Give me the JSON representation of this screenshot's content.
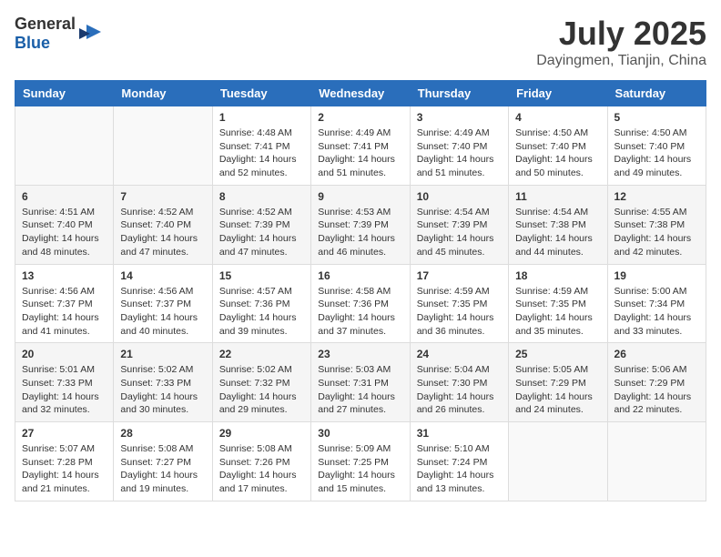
{
  "header": {
    "logo_general": "General",
    "logo_blue": "Blue",
    "month": "July 2025",
    "location": "Dayingmen, Tianjin, China"
  },
  "weekdays": [
    "Sunday",
    "Monday",
    "Tuesday",
    "Wednesday",
    "Thursday",
    "Friday",
    "Saturday"
  ],
  "weeks": [
    [
      {
        "day": "",
        "sunrise": "",
        "sunset": "",
        "daylight": ""
      },
      {
        "day": "",
        "sunrise": "",
        "sunset": "",
        "daylight": ""
      },
      {
        "day": "1",
        "sunrise": "Sunrise: 4:48 AM",
        "sunset": "Sunset: 7:41 PM",
        "daylight": "Daylight: 14 hours and 52 minutes."
      },
      {
        "day": "2",
        "sunrise": "Sunrise: 4:49 AM",
        "sunset": "Sunset: 7:41 PM",
        "daylight": "Daylight: 14 hours and 51 minutes."
      },
      {
        "day": "3",
        "sunrise": "Sunrise: 4:49 AM",
        "sunset": "Sunset: 7:40 PM",
        "daylight": "Daylight: 14 hours and 51 minutes."
      },
      {
        "day": "4",
        "sunrise": "Sunrise: 4:50 AM",
        "sunset": "Sunset: 7:40 PM",
        "daylight": "Daylight: 14 hours and 50 minutes."
      },
      {
        "day": "5",
        "sunrise": "Sunrise: 4:50 AM",
        "sunset": "Sunset: 7:40 PM",
        "daylight": "Daylight: 14 hours and 49 minutes."
      }
    ],
    [
      {
        "day": "6",
        "sunrise": "Sunrise: 4:51 AM",
        "sunset": "Sunset: 7:40 PM",
        "daylight": "Daylight: 14 hours and 48 minutes."
      },
      {
        "day": "7",
        "sunrise": "Sunrise: 4:52 AM",
        "sunset": "Sunset: 7:40 PM",
        "daylight": "Daylight: 14 hours and 47 minutes."
      },
      {
        "day": "8",
        "sunrise": "Sunrise: 4:52 AM",
        "sunset": "Sunset: 7:39 PM",
        "daylight": "Daylight: 14 hours and 47 minutes."
      },
      {
        "day": "9",
        "sunrise": "Sunrise: 4:53 AM",
        "sunset": "Sunset: 7:39 PM",
        "daylight": "Daylight: 14 hours and 46 minutes."
      },
      {
        "day": "10",
        "sunrise": "Sunrise: 4:54 AM",
        "sunset": "Sunset: 7:39 PM",
        "daylight": "Daylight: 14 hours and 45 minutes."
      },
      {
        "day": "11",
        "sunrise": "Sunrise: 4:54 AM",
        "sunset": "Sunset: 7:38 PM",
        "daylight": "Daylight: 14 hours and 44 minutes."
      },
      {
        "day": "12",
        "sunrise": "Sunrise: 4:55 AM",
        "sunset": "Sunset: 7:38 PM",
        "daylight": "Daylight: 14 hours and 42 minutes."
      }
    ],
    [
      {
        "day": "13",
        "sunrise": "Sunrise: 4:56 AM",
        "sunset": "Sunset: 7:37 PM",
        "daylight": "Daylight: 14 hours and 41 minutes."
      },
      {
        "day": "14",
        "sunrise": "Sunrise: 4:56 AM",
        "sunset": "Sunset: 7:37 PM",
        "daylight": "Daylight: 14 hours and 40 minutes."
      },
      {
        "day": "15",
        "sunrise": "Sunrise: 4:57 AM",
        "sunset": "Sunset: 7:36 PM",
        "daylight": "Daylight: 14 hours and 39 minutes."
      },
      {
        "day": "16",
        "sunrise": "Sunrise: 4:58 AM",
        "sunset": "Sunset: 7:36 PM",
        "daylight": "Daylight: 14 hours and 37 minutes."
      },
      {
        "day": "17",
        "sunrise": "Sunrise: 4:59 AM",
        "sunset": "Sunset: 7:35 PM",
        "daylight": "Daylight: 14 hours and 36 minutes."
      },
      {
        "day": "18",
        "sunrise": "Sunrise: 4:59 AM",
        "sunset": "Sunset: 7:35 PM",
        "daylight": "Daylight: 14 hours and 35 minutes."
      },
      {
        "day": "19",
        "sunrise": "Sunrise: 5:00 AM",
        "sunset": "Sunset: 7:34 PM",
        "daylight": "Daylight: 14 hours and 33 minutes."
      }
    ],
    [
      {
        "day": "20",
        "sunrise": "Sunrise: 5:01 AM",
        "sunset": "Sunset: 7:33 PM",
        "daylight": "Daylight: 14 hours and 32 minutes."
      },
      {
        "day": "21",
        "sunrise": "Sunrise: 5:02 AM",
        "sunset": "Sunset: 7:33 PM",
        "daylight": "Daylight: 14 hours and 30 minutes."
      },
      {
        "day": "22",
        "sunrise": "Sunrise: 5:02 AM",
        "sunset": "Sunset: 7:32 PM",
        "daylight": "Daylight: 14 hours and 29 minutes."
      },
      {
        "day": "23",
        "sunrise": "Sunrise: 5:03 AM",
        "sunset": "Sunset: 7:31 PM",
        "daylight": "Daylight: 14 hours and 27 minutes."
      },
      {
        "day": "24",
        "sunrise": "Sunrise: 5:04 AM",
        "sunset": "Sunset: 7:30 PM",
        "daylight": "Daylight: 14 hours and 26 minutes."
      },
      {
        "day": "25",
        "sunrise": "Sunrise: 5:05 AM",
        "sunset": "Sunset: 7:29 PM",
        "daylight": "Daylight: 14 hours and 24 minutes."
      },
      {
        "day": "26",
        "sunrise": "Sunrise: 5:06 AM",
        "sunset": "Sunset: 7:29 PM",
        "daylight": "Daylight: 14 hours and 22 minutes."
      }
    ],
    [
      {
        "day": "27",
        "sunrise": "Sunrise: 5:07 AM",
        "sunset": "Sunset: 7:28 PM",
        "daylight": "Daylight: 14 hours and 21 minutes."
      },
      {
        "day": "28",
        "sunrise": "Sunrise: 5:08 AM",
        "sunset": "Sunset: 7:27 PM",
        "daylight": "Daylight: 14 hours and 19 minutes."
      },
      {
        "day": "29",
        "sunrise": "Sunrise: 5:08 AM",
        "sunset": "Sunset: 7:26 PM",
        "daylight": "Daylight: 14 hours and 17 minutes."
      },
      {
        "day": "30",
        "sunrise": "Sunrise: 5:09 AM",
        "sunset": "Sunset: 7:25 PM",
        "daylight": "Daylight: 14 hours and 15 minutes."
      },
      {
        "day": "31",
        "sunrise": "Sunrise: 5:10 AM",
        "sunset": "Sunset: 7:24 PM",
        "daylight": "Daylight: 14 hours and 13 minutes."
      },
      {
        "day": "",
        "sunrise": "",
        "sunset": "",
        "daylight": ""
      },
      {
        "day": "",
        "sunrise": "",
        "sunset": "",
        "daylight": ""
      }
    ]
  ]
}
